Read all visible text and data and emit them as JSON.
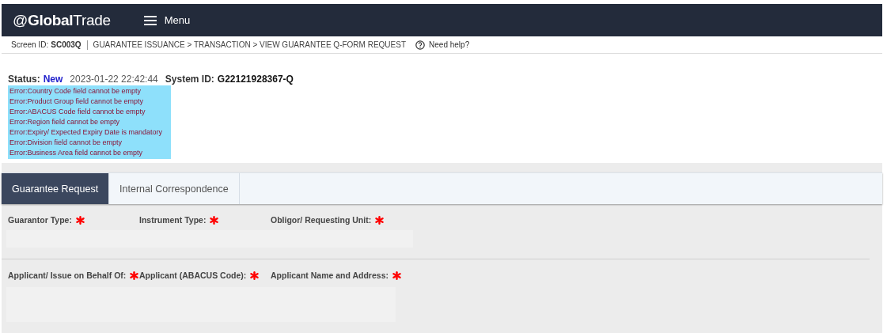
{
  "header": {
    "logo": "@**Global**Trade",
    "menu_label": "Menu"
  },
  "breadcrumb": {
    "screen_id_label": "Screen ID:",
    "screen_id": "SC003Q",
    "path": "GUARANTEE ISSUANCE > TRANSACTION > VIEW GUARANTEE Q-FORM REQUEST",
    "help": "Need help?"
  },
  "status": {
    "label": "Status:",
    "value": "New",
    "timestamp": "2023-01-22 22:42:44",
    "system_id_label": "System ID:",
    "system_id": "G22121928367-Q"
  },
  "errors": [
    "Error:Country Code field cannot be empty",
    "Error:Product Group field cannot be empty",
    "Error:ABACUS Code field cannot be empty",
    "Error:Region field cannot be empty",
    "Error:Expiry/ Expected Expiry Date is mandatory",
    "Error:Division field cannot be empty",
    "Error:Business Area field cannot be empty"
  ],
  "tabs": [
    {
      "label": "Guarantee Request",
      "selected": true
    },
    {
      "label": "Internal Correspondence",
      "selected": false
    }
  ],
  "form_rows": [
    {
      "fields": [
        {
          "label": "Guarantor Type:",
          "required": true
        },
        {
          "label": "Instrument Type:",
          "required": true
        },
        {
          "label": "Obligor/ Requesting Unit:",
          "required": true
        }
      ]
    },
    {
      "fields": [
        {
          "label": "Applicant/ Issue on Behalf Of:",
          "required": true
        },
        {
          "label": "Applicant (ABACUS Code):",
          "required": true
        },
        {
          "label": "Applicant Name and Address:",
          "required": true
        }
      ]
    }
  ]
}
